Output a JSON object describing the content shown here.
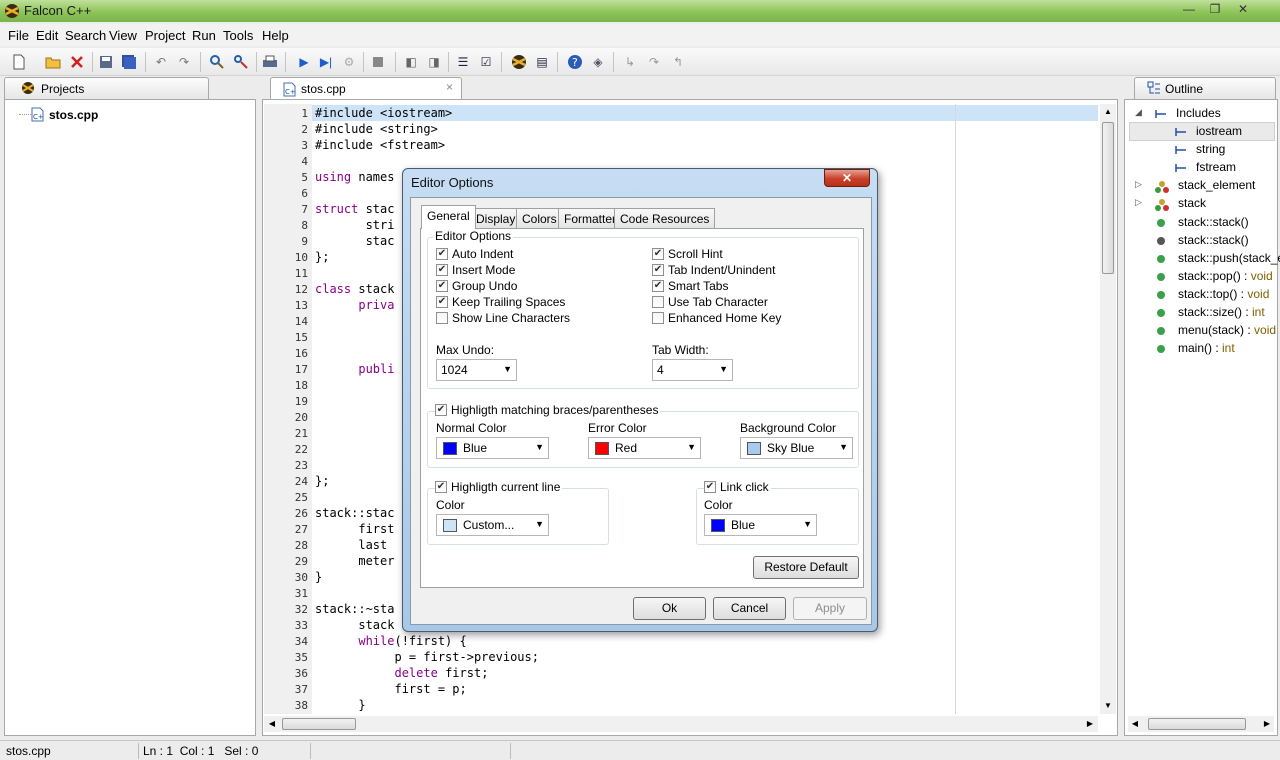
{
  "app": {
    "title": "Falcon C++"
  },
  "window_controls": {
    "minimize": "—",
    "maximize": "❐",
    "close": "✕"
  },
  "menu": [
    "File",
    "Edit",
    "Search",
    "View",
    "Project",
    "Run",
    "Tools",
    "Help"
  ],
  "projects_pane": {
    "tab_label": "Projects",
    "tree": {
      "file": "stos.cpp"
    }
  },
  "editor": {
    "tab_label": "stos.cpp",
    "tab_close": "×",
    "lines": [
      "#include <iostream>",
      "#include <string>",
      "#include <fstream>",
      "",
      "using names",
      "",
      "struct stac",
      "       stri",
      "       stac",
      "};",
      "",
      "class stack",
      "      priva",
      "",
      "",
      "",
      "      publi",
      "",
      "",
      "",
      "",
      "",
      "",
      "};",
      "",
      "stack::stac",
      "      first",
      "      last",
      "      meter",
      "}",
      "",
      "stack::~sta",
      "      stack",
      "      while(!first) {",
      "           p = first->previous;",
      "           delete first;",
      "           first = p;",
      "      }"
    ]
  },
  "outline": {
    "tab_label": "Outline",
    "items": [
      {
        "label": "Includes",
        "type": ""
      },
      {
        "label": "iostream",
        "type": ""
      },
      {
        "label": "string",
        "type": ""
      },
      {
        "label": "fstream",
        "type": ""
      },
      {
        "label": "stack_element",
        "type": ""
      },
      {
        "label": "stack",
        "type": ""
      },
      {
        "label": "stack::stack()",
        "type": ""
      },
      {
        "label": "stack::stack()",
        "type": ""
      },
      {
        "label": "stack::push(stack_e",
        "type": ""
      },
      {
        "label": "stack::pop() : ",
        "type": "void"
      },
      {
        "label": "stack::top() : ",
        "type": "void"
      },
      {
        "label": "stack::size() : ",
        "type": "int"
      },
      {
        "label": "menu(stack) : ",
        "type": "void"
      },
      {
        "label": "main() : ",
        "type": "int"
      }
    ]
  },
  "status_bar": {
    "file": "stos.cpp",
    "position": "Ln : 1  Col : 1   Sel : 0"
  },
  "dialog": {
    "title": "Editor Options",
    "close": "✕",
    "tabs": [
      "General",
      "Display",
      "Colors",
      "Formatter",
      "Code Resources"
    ],
    "active_tab": "General",
    "editor_options": {
      "label": "Editor Options",
      "left": [
        {
          "label": "Auto Indent",
          "checked": true
        },
        {
          "label": "Insert Mode",
          "checked": true
        },
        {
          "label": "Group Undo",
          "checked": true
        },
        {
          "label": "Keep Trailing Spaces",
          "checked": true
        },
        {
          "label": "Show Line Characters",
          "checked": false
        }
      ],
      "right": [
        {
          "label": "Scroll Hint",
          "checked": true
        },
        {
          "label": "Tab Indent/Unindent",
          "checked": true
        },
        {
          "label": "Smart Tabs",
          "checked": true
        },
        {
          "label": "Use Tab Character",
          "checked": false
        },
        {
          "label": "Enhanced Home Key",
          "checked": false
        }
      ],
      "max_undo_label": "Max Undo:",
      "max_undo_value": "1024",
      "tab_width_label": "Tab Width:",
      "tab_width_value": "4"
    },
    "braces": {
      "label": "Highligth matching braces/parentheses",
      "checked": true,
      "normal_label": "Normal Color",
      "normal_value": "Blue",
      "normal_color": "#0000ff",
      "error_label": "Error Color",
      "error_value": "Red",
      "error_color": "#ff0000",
      "bg_label": "Background Color",
      "bg_value": "Sky Blue",
      "bg_color": "#a6caf0"
    },
    "current_line": {
      "label": "Highligth current line",
      "checked": true,
      "color_label": "Color",
      "color_value": "Custom...",
      "color": "#cde4f8"
    },
    "link_click": {
      "label": "Link click",
      "checked": true,
      "color_label": "Color",
      "color_value": "Blue",
      "color": "#0000ff"
    },
    "restore_default": "Restore Default",
    "ok": "Ok",
    "cancel": "Cancel",
    "apply": "Apply"
  }
}
